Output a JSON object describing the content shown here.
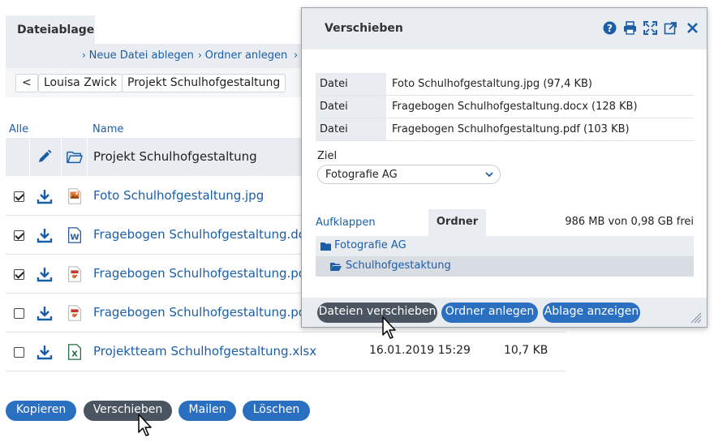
{
  "app": {
    "tab_label": "Dateiablage"
  },
  "toolbar": {
    "new_file": "Neue Datei ablegen",
    "new_folder": "Ordner anlegen"
  },
  "breadcrumb": {
    "back": "<",
    "items": [
      "Louisa Zwick",
      "Projekt Schulhofgestaltung"
    ]
  },
  "table": {
    "select_all": "Alle",
    "name_header": "Name",
    "current_folder": "Projekt Schulhofgestaltung",
    "rows": [
      {
        "name": "Foto Schulhofgestaltung.jpg",
        "checked": true,
        "type": "image",
        "date": "",
        "size": ""
      },
      {
        "name": "Fragebogen Schulhofgestaltung.docx",
        "checked": true,
        "type": "word",
        "date": "",
        "size": ""
      },
      {
        "name": "Fragebogen Schulhofgestaltung.pdf",
        "checked": true,
        "type": "pdf",
        "date": "",
        "size": ""
      },
      {
        "name": "Fragebogen Schulhofgestaltung.pdf",
        "checked": false,
        "type": "pdf",
        "date": "",
        "size": ""
      },
      {
        "name": "Projektteam Schulhofgestaltung.xlsx",
        "checked": false,
        "type": "excel",
        "date": "16.01.2019 15:29",
        "size": "10,7 KB"
      }
    ]
  },
  "actions": {
    "copy": "Kopieren",
    "move": "Verschieben",
    "mail": "Mailen",
    "delete": "Löschen"
  },
  "modal": {
    "title": "Verschieben",
    "files": [
      {
        "kind": "Datei",
        "value": "Foto Schulhofgestaltung.jpg (97,4 KB)"
      },
      {
        "kind": "Datei",
        "value": "Fragebogen Schulhofgestaltung.docx (128 KB)"
      },
      {
        "kind": "Datei",
        "value": "Fragebogen Schulhofgestaltung.pdf (103 KB)"
      }
    ],
    "target_label": "Ziel",
    "target_value": "Fotografie AG",
    "expand_link": "Aufklappen",
    "folders_header": "Ordner",
    "quota": "986 MB von 0,98 GB frei",
    "folders": [
      "Fotografie AG",
      "Schulhofgestaktung"
    ],
    "btn_move_files": "Dateien verschieben",
    "btn_new_folder": "Ordner anlegen",
    "btn_show_storage": "Ablage anzeigen"
  },
  "colors": {
    "accent_blue": "#2a6fc0",
    "link_blue": "#1b5ea8",
    "dark_button": "#4a5561",
    "panel_gray": "#e9edf2"
  }
}
